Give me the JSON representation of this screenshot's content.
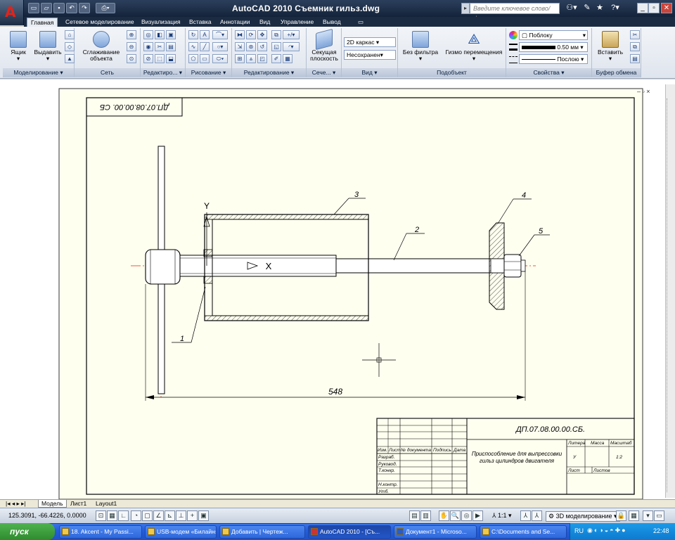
{
  "window": {
    "title": "AutoCAD 2010    Съемник гильз.dwg",
    "search_placeholder": "Введите ключевое слово/фразу"
  },
  "ribbon_tabs": [
    "Главная",
    "Сетевое моделирование",
    "Визуализация",
    "Вставка",
    "Аннотации",
    "Вид",
    "Управление",
    "Вывод"
  ],
  "ribbon": {
    "modeling": {
      "title": "Моделирование ▾",
      "box": "Ящик",
      "extrude": "Выдавить"
    },
    "mesh": {
      "title": "Сеть",
      "smooth": "Сглаживание объекта"
    },
    "edit3d": {
      "title": "Редактиро... ▾"
    },
    "draw": {
      "title": "Рисование ▾"
    },
    "modify": {
      "title": "Редактирование ▾"
    },
    "section": {
      "title": "Сече... ▾",
      "plane": "Секущая плоскость"
    },
    "view": {
      "title": "Вид ▾",
      "visual_style": "2D каркас",
      "unsaved": "Несохранен"
    },
    "subobject": {
      "title": "Подобъект",
      "filter": "Без фильтра",
      "gizmo": "Гизмо перемещения"
    },
    "properties": {
      "title": "Свойства ▾",
      "color": "Поблоку",
      "lineweight": "0.50 мм",
      "linetype": "Послою"
    },
    "clipboard": {
      "title": "Буфер обмена",
      "paste": "Вставить"
    }
  },
  "drawing": {
    "stamp_rotated": "ДП.07.08.00.00. СБ",
    "axis_y": "Y",
    "axis_x": "X",
    "callouts": [
      "1",
      "2",
      "3",
      "4",
      "5"
    ],
    "dimension": "548",
    "title_block": {
      "designation": "ДП.07.08.00.00.СБ.",
      "name_line1": "Приспособление для выпрессовки",
      "name_line2": "гильз цилиндров двигателя",
      "col_headers": [
        "Изм.",
        "Лист",
        "№ документа",
        "Подпись",
        "Дата"
      ],
      "rows": [
        "Разраб.",
        "Руковод.",
        "Т.конкр.",
        "",
        "Н.контр.",
        "Утб."
      ],
      "litera": "Литера",
      "massa": "Масса",
      "masshtab": "Масштаб",
      "litera_val": "У",
      "masshtab_val": "1:2",
      "list": "Лист",
      "listov": "Листов"
    }
  },
  "layout_tabs": [
    "Модель",
    "Лист1",
    "Layout1"
  ],
  "status": {
    "coords": "125.3091, -66.4226, 0.0000",
    "scale": "1:1 ▾",
    "workspace": "3D моделирование ▾"
  },
  "taskbar": {
    "start": "пуск",
    "tasks": [
      "18. Akcent - My Passi...",
      "USB-модем «Билайн»",
      "Добавить | Чертеж...",
      "AutoCAD 2010 - [Съ...",
      "Документ1 - Microso...",
      "C:\\Documents and Se..."
    ],
    "lang": "RU",
    "clock": "22:48"
  }
}
